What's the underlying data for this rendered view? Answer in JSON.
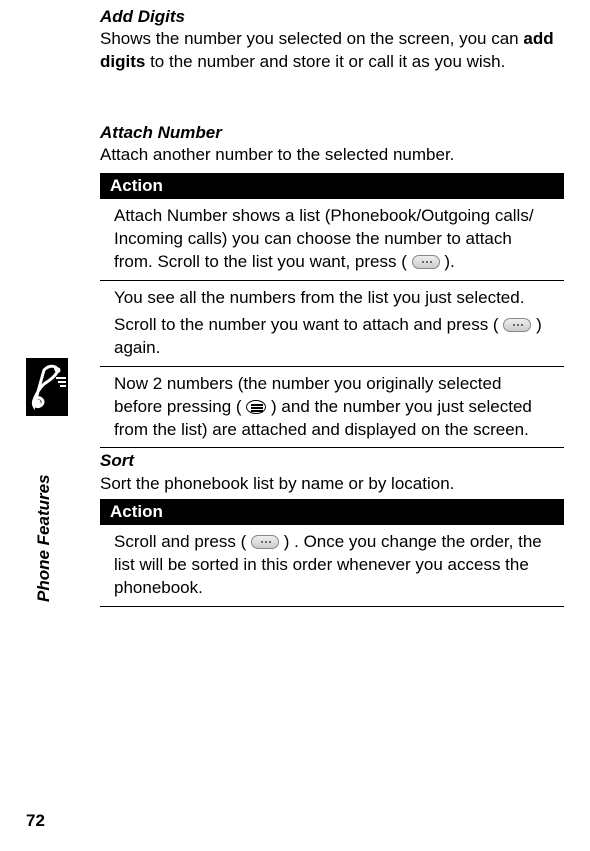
{
  "sideTab": {
    "label": "Phone Features"
  },
  "pageNumber": "72",
  "addDigits": {
    "title": "Add Digits",
    "body_a": "Shows the number you selected on the screen, you can ",
    "body_b": "add digits",
    "body_c": " to the number and store it or call it as you wish."
  },
  "attachNumber": {
    "title": "Attach Number",
    "intro": "Attach another number to the selected number.",
    "actionHeader": "Action",
    "row1_a": "Attach Number shows a list (Phonebook/Outgoing calls/ Incoming calls) you can choose the number to attach from. Scroll to the list you want, press ( ",
    "row1_b": " ).",
    "row2": "You see all the numbers from the list you just selected.",
    "row3_a": "Scroll to the number you want to attach and press ( ",
    "row3_b": " ) again.",
    "row4_a": "Now 2 numbers (the number you originally selected before pressing ( ",
    "row4_b": " ) and the number you just selected from the list) are attached and displayed on the screen."
  },
  "sort": {
    "title": "Sort",
    "intro": "Sort the phonebook list by name or by location.",
    "actionHeader": "Action",
    "row1_a": "Scroll and press ( ",
    "row1_b": " ) . Once you change the order, the list will be sorted in this order whenever you access the phonebook."
  }
}
